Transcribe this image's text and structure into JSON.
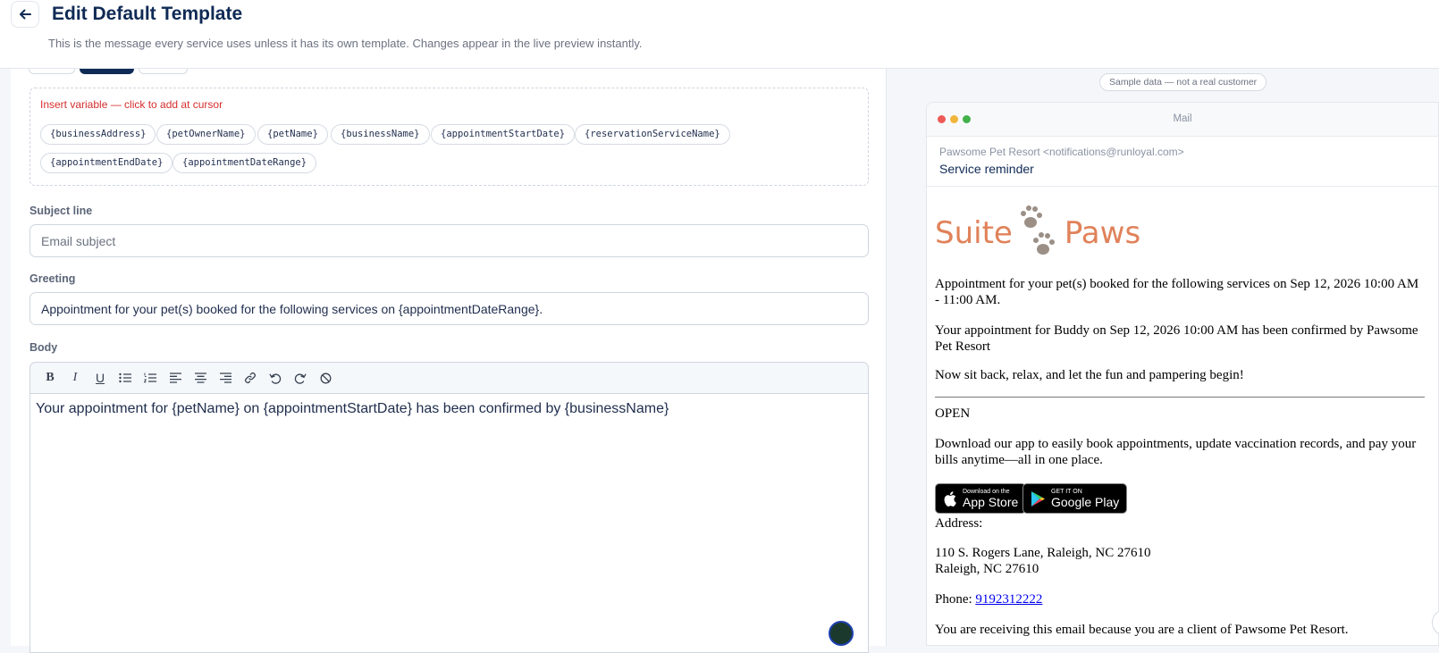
{
  "header": {
    "title": "Edit Default Template",
    "subtitle": "This is the message every service uses unless it has its own template. Changes appear in the live preview instantly."
  },
  "variables": {
    "label": "Insert variable — click to add at cursor",
    "chips": [
      "{businessAddress}",
      "{petOwnerName}",
      "{petName}",
      "{businessName}",
      "{appointmentStartDate}",
      "{reservationServiceName}",
      "{appointmentEndDate}",
      "{appointmentDateRange}"
    ]
  },
  "subject": {
    "label": "Subject line",
    "value": "",
    "placeholder": "Email subject"
  },
  "greeting": {
    "label": "Greeting",
    "value": "Appointment for your pet(s) booked for the following services on {appointmentDateRange}."
  },
  "body": {
    "label": "Body",
    "toolbar": [
      "bold",
      "italic",
      "underline",
      "bullet-list",
      "numbered-list",
      "align-left",
      "align-center",
      "align-right",
      "link",
      "undo",
      "redo",
      "clear-format"
    ],
    "content": "Your appointment for {petName} on {appointmentStartDate} has been confirmed by {businessName}"
  },
  "preview": {
    "sample_note": "Sample data — not a real customer",
    "window_title": "Mail",
    "from": "Pawsome Pet Resort <notifications@runloyal.com>",
    "subject": "Service reminder",
    "brand_left": "Suite",
    "brand_right": "Paws",
    "greeting": "Appointment for your pet(s) booked for the following services on Sep 12, 2026 10:00 AM - 11:00 AM.",
    "body": "Your appointment for Buddy on Sep 12, 2026 10:00 AM has been confirmed by Pawsome Pet Resort",
    "closing": "Now sit back, relax, and let the fun and pampering begin!",
    "open_label": "OPEN",
    "app_promo": "Download our app to easily book appointments, update vaccination records, and pay your bills anytime—all in one place.",
    "app_store": {
      "small": "Download on the",
      "big": "App Store"
    },
    "google_play": {
      "small": "GET IT ON",
      "big": "Google Play"
    },
    "address_label": "Address:",
    "address_line1": "110 S. Rogers Lane, Raleigh, NC 27610",
    "address_line2": "Raleigh, NC 27610",
    "phone_label": "Phone:",
    "phone": "9192312222",
    "footer": "You are receiving this email because you are a client of Pawsome Pet Resort."
  },
  "colors": {
    "primary": "#0f2a55",
    "variable_label": "#d62d2d",
    "brand": "#e0825a",
    "link": "#0000ee"
  }
}
